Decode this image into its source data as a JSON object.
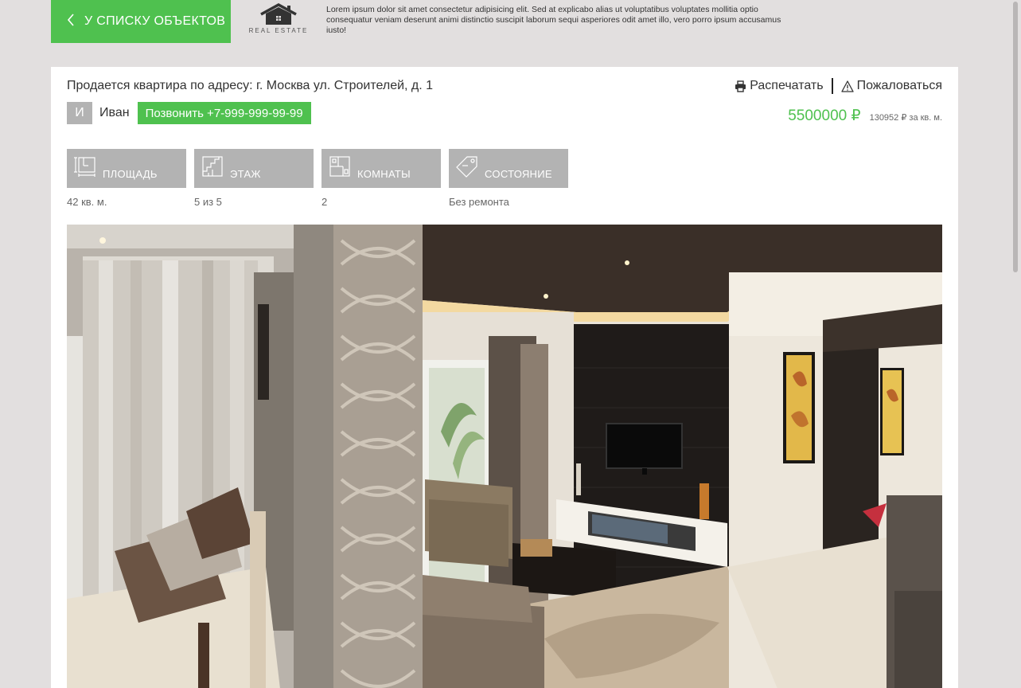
{
  "header": {
    "back_label": "У СПИСКУ ОБЪЕКТОВ",
    "logo_text": "REAL ESTATE",
    "description": "Lorem ipsum dolor sit amet consectetur adipisicing elit. Sed at explicabo alias ut voluptatibus voluptates mollitia optio consequatur veniam deserunt animi distinctio suscipit laborum sequi asperiores odit amet illo, vero porro ipsum accusamus iusto!"
  },
  "listing": {
    "address": "Продается квартира по адресу: г. Москва ул. Строителей, д. 1",
    "print_label": "Распечатать",
    "report_label": "Пожаловаться",
    "agent_initial": "И",
    "agent_name": "Иван",
    "call_label": "Позвонить +7-999-999-99-99",
    "price": "5500000 ₽",
    "price_per_m": "130952 ₽ за кв. м."
  },
  "features": [
    {
      "label": "ПЛОЩАДЬ",
      "value": "42 кв. м.",
      "icon": "area-icon"
    },
    {
      "label": "ЭТАЖ",
      "value": "5 из 5",
      "icon": "stairs-icon"
    },
    {
      "label": "КОМНАТЫ",
      "value": "2",
      "icon": "floorplan-icon"
    },
    {
      "label": "СОСТОЯНИЕ",
      "value": "Без ремонта",
      "icon": "tag-icon"
    }
  ],
  "colors": {
    "accent": "#4fc14f",
    "tile": "#b3b3b3",
    "page_bg": "#e2dfdf"
  }
}
